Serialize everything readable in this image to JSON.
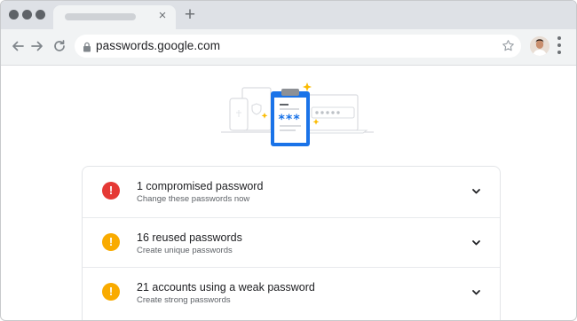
{
  "browser": {
    "url": "passwords.google.com",
    "tab_close_glyph": "×",
    "new_tab_glyph": "+"
  },
  "icons": {
    "back": "arrow-left-icon",
    "forward": "arrow-right-icon",
    "reload": "reload-icon",
    "lock": "lock-icon",
    "star": "star-icon",
    "menu": "kebab-menu-icon",
    "expand": "chevron-down-icon"
  },
  "colors": {
    "danger": "#e53935",
    "warning": "#f9ab00",
    "accent_blue": "#1a73e8"
  },
  "illustration": {
    "masked_password": "***"
  },
  "checks": [
    {
      "title": "1 compromised password",
      "subtitle": "Change these passwords now",
      "badge": "!",
      "severity": "danger"
    },
    {
      "title": "16 reused passwords",
      "subtitle": "Create unique passwords",
      "badge": "!",
      "severity": "warning"
    },
    {
      "title": "21 accounts using a weak password",
      "subtitle": "Create strong passwords",
      "badge": "!",
      "severity": "warning"
    }
  ]
}
